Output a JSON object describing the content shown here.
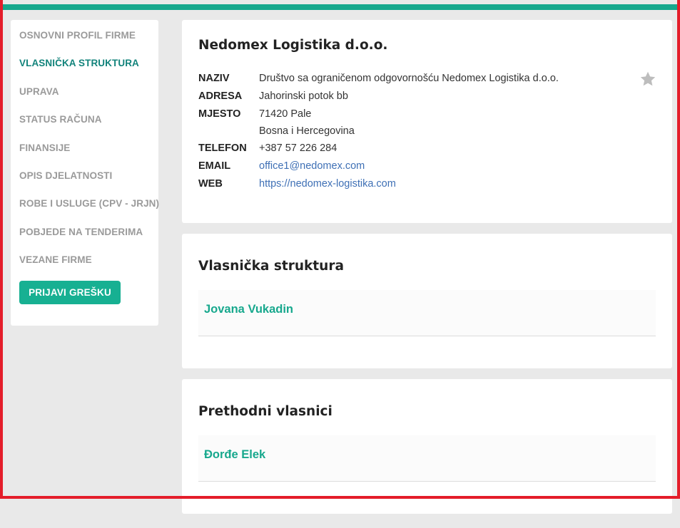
{
  "sidebar": {
    "items": [
      {
        "label": "OSNOVNI PROFIL FIRME",
        "active": false
      },
      {
        "label": "VLASNIČKA STRUKTURA",
        "active": true
      },
      {
        "label": "UPRAVA",
        "active": false
      },
      {
        "label": "STATUS RAČUNA",
        "active": false
      },
      {
        "label": "FINANSIJE",
        "active": false
      },
      {
        "label": "OPIS DJELATNOSTI",
        "active": false
      },
      {
        "label": "ROBE I USLUGE (CPV - JRJN)",
        "active": false
      },
      {
        "label": "POBJEDE NA TENDERIMA",
        "active": false
      },
      {
        "label": "VEZANE FIRME",
        "active": false
      }
    ],
    "report_button": "PRIJAVI GREŠKU"
  },
  "company": {
    "title": "Nedomex Logistika d.o.o.",
    "labels": {
      "name": "NAZIV",
      "address": "ADRESA",
      "city": "MJESTO",
      "phone": "TELEFON",
      "email": "EMAIL",
      "web": "WEB"
    },
    "name": "Društvo sa ograničenom odgovornošću Nedomex Logistika d.o.o.",
    "address": "Jahorinski potok bb",
    "city": "71420 Pale",
    "country": "Bosna i Hercegovina",
    "phone": "+387 57 226 284",
    "email": "office1@nedomex.com",
    "web": "https://nedomex-logistika.com",
    "favorite_icon": "star-icon"
  },
  "ownership": {
    "title": "Vlasnička struktura",
    "owners": [
      "Jovana Vukadin"
    ]
  },
  "previous_owners": {
    "title": "Prethodni vlasnici",
    "owners": [
      "Đorđe Elek"
    ]
  },
  "colors": {
    "accent": "#17a88d",
    "active_nav": "#12837b",
    "link": "#3f70b5",
    "highlight": "#e41d2a"
  }
}
